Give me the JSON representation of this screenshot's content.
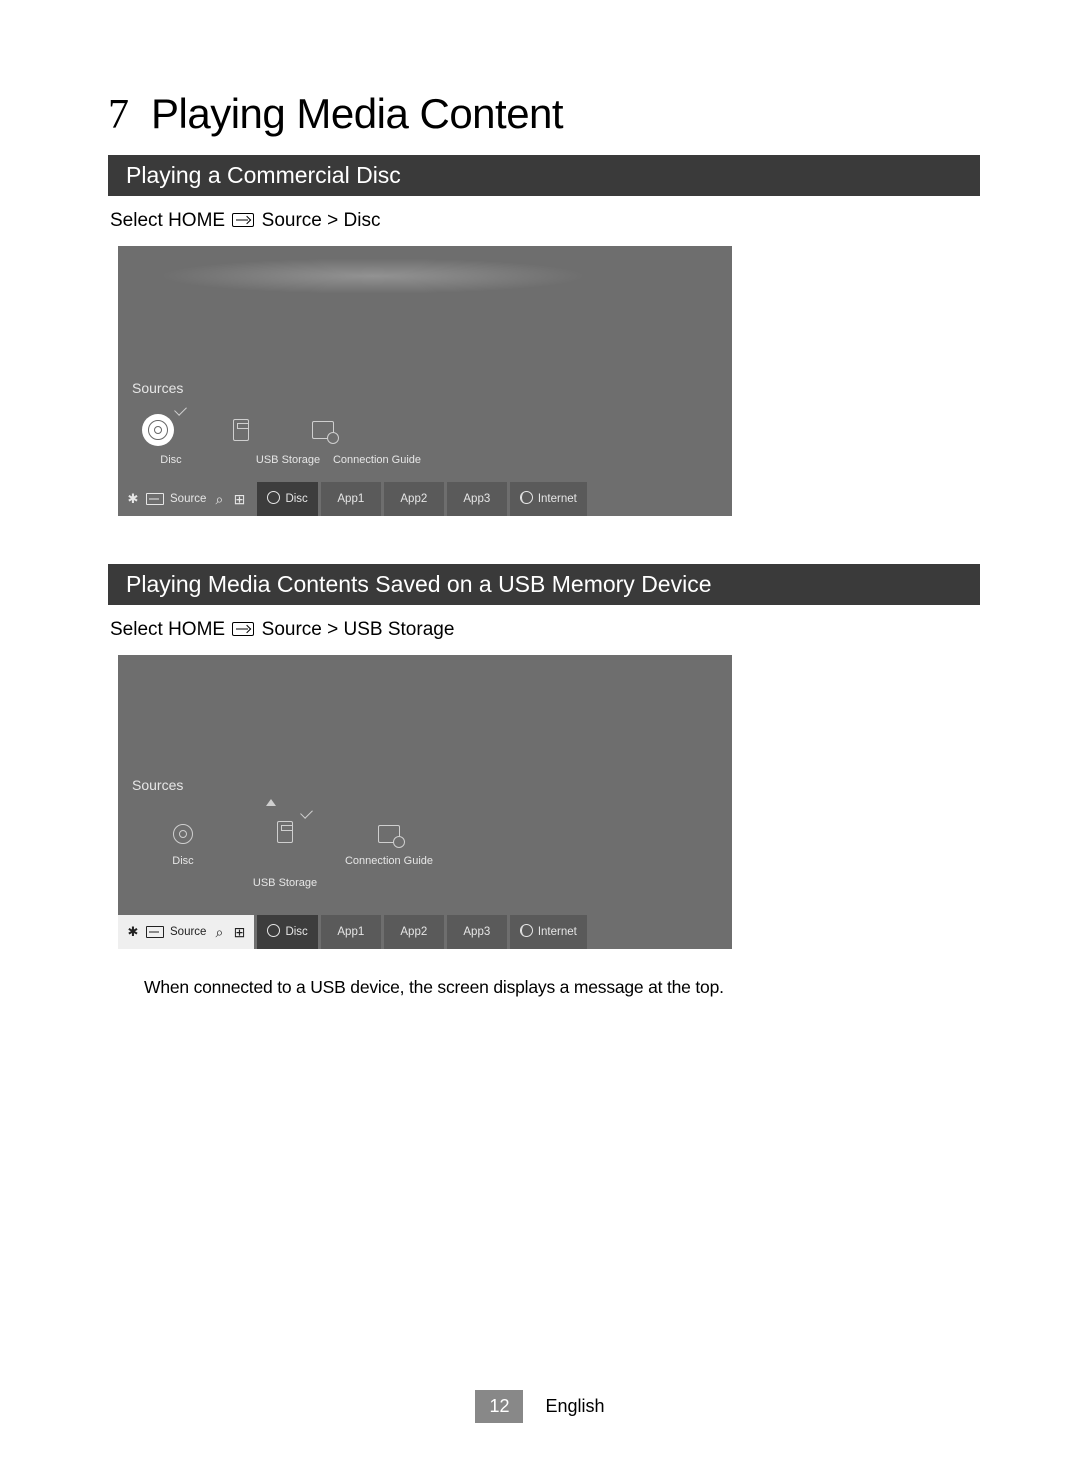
{
  "chapter": {
    "number": "7",
    "title": "Playing Media Content"
  },
  "section1": {
    "heading": "Playing  a Commercial Disc",
    "breadcrumb_prefix": "Select HOME ",
    "breadcrumb_suffix": " Source > Disc",
    "tv": {
      "sources_label": "Sources",
      "items": [
        "Disc",
        "USB Storage",
        "Connection Guide"
      ],
      "selected": "Disc",
      "taskbar": {
        "source_label": "Source",
        "cells": [
          "Disc",
          "App1",
          "App2",
          "App3",
          "Internet"
        ]
      }
    }
  },
  "section2": {
    "heading": "Playing Media Contents Saved on a USB Memory Device",
    "breadcrumb_prefix": "Select HOME ",
    "breadcrumb_suffix": " Source > USB Storage",
    "tv": {
      "sources_label": "Sources",
      "items": [
        "Disc",
        "USB Storage",
        "Connection Guide"
      ],
      "selected": "USB Storage",
      "taskbar": {
        "source_label": "Source",
        "cells": [
          "Disc",
          "App1",
          "App2",
          "App3",
          "Internet"
        ]
      }
    },
    "note": "When connected to a USB device, the screen displays a message at the top."
  },
  "footer": {
    "page": "12",
    "lang": "English"
  }
}
